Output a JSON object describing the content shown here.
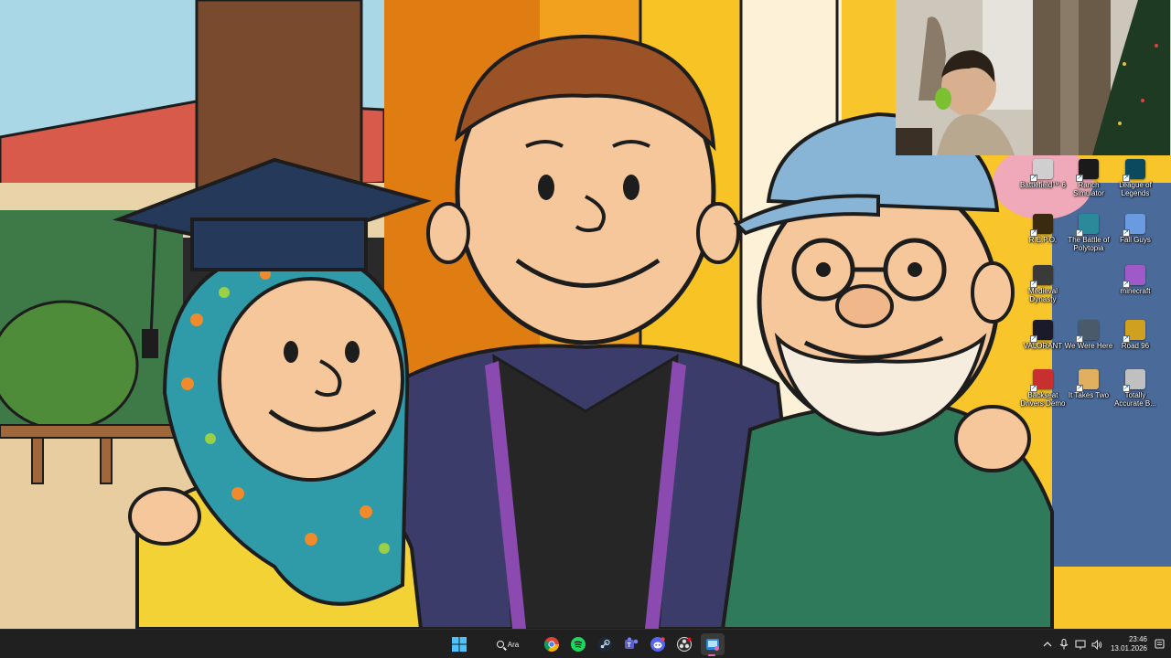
{
  "desktop": {
    "icons": [
      {
        "label": "Battlefield™ 6",
        "color": "#cfcfcf",
        "glyph": "BF"
      },
      {
        "label": "Ranch Simulator",
        "color": "#1a1a1a",
        "glyph": "RS"
      },
      {
        "label": "League of Legends",
        "color": "#0b4a5e",
        "glyph": "L"
      },
      {
        "label": "R.E.P.O.",
        "color": "#3a2a10",
        "glyph": "R"
      },
      {
        "label": "The Battle of Polytopia",
        "color": "#2a8a9a",
        "glyph": "P"
      },
      {
        "label": "Fall Guys",
        "color": "#6a9ae0",
        "glyph": "FG"
      },
      {
        "label": "Medieval Dynasty",
        "color": "#3a3a3a",
        "glyph": "MD"
      },
      {
        "label": "minecraft",
        "color": "#a05ac8",
        "glyph": "M"
      },
      {
        "label": "VALORANT",
        "color": "#1a1a2a",
        "glyph": "V"
      },
      {
        "label": "We Were Here",
        "color": "#4a5a6a",
        "glyph": "W"
      },
      {
        "label": "Road 96",
        "color": "#d0a020",
        "glyph": "96"
      },
      {
        "label": "Backseat Drivers Demo",
        "color": "#c83030",
        "glyph": "B"
      },
      {
        "label": "It Takes Two",
        "color": "#e0b060",
        "glyph": "2"
      },
      {
        "label": "Totally Accurate B...",
        "color": "#c0c0c0",
        "glyph": "T"
      }
    ]
  },
  "taskbar": {
    "search_label": "Ara",
    "apps": [
      {
        "name": "chrome-icon"
      },
      {
        "name": "spotify-icon"
      },
      {
        "name": "steam-icon"
      },
      {
        "name": "teams-icon"
      },
      {
        "name": "discord-icon"
      },
      {
        "name": "obs-icon"
      },
      {
        "name": "snipping-tool-icon"
      }
    ],
    "tray": {
      "time": "23:46",
      "date": "13.01.2026"
    }
  }
}
